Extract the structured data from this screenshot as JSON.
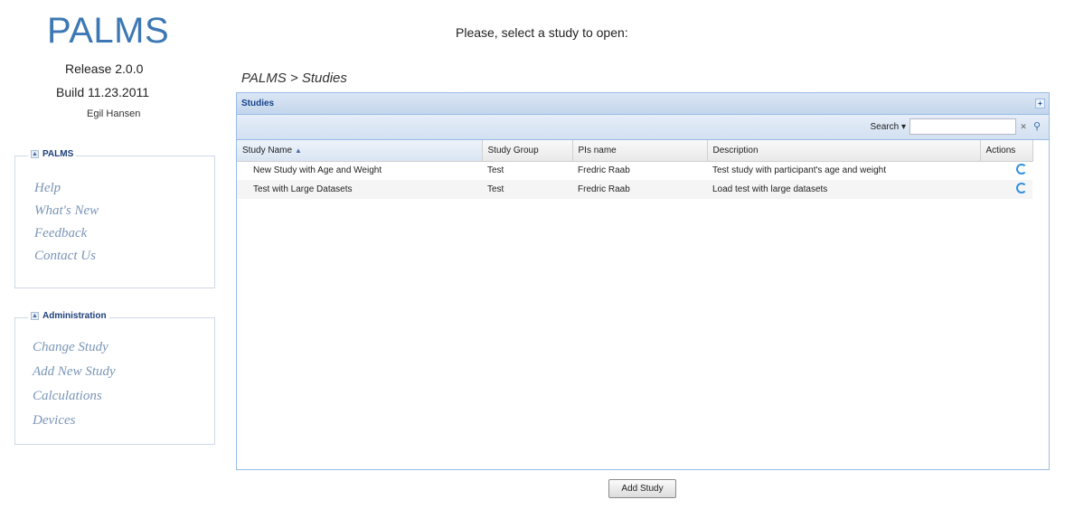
{
  "app": {
    "logo": "PALMS",
    "release": "Release 2.0.0",
    "build": "Build 11.23.2011",
    "author": "Egil Hansen"
  },
  "sidebar": {
    "palms": {
      "title": "PALMS",
      "items": [
        {
          "label": "Help"
        },
        {
          "label": "What's New"
        },
        {
          "label": "Feedback"
        },
        {
          "label": "Contact Us"
        }
      ]
    },
    "administration": {
      "title": "Administration",
      "items": [
        {
          "label": "Change Study"
        },
        {
          "label": "Add New Study"
        },
        {
          "label": "Calculations"
        },
        {
          "label": "Devices"
        }
      ]
    }
  },
  "main": {
    "prompt": "Please, select a study to open:",
    "breadcrumb": "PALMS > Studies",
    "grid": {
      "title": "Studies",
      "search_label": "Search ▾",
      "search_value": "",
      "columns": [
        "Study Name",
        "Study Group",
        "PIs name",
        "Description",
        "Actions"
      ],
      "sort_indicator": "▲",
      "rows": [
        {
          "name": "New Study with Age and Weight",
          "group": "Test",
          "pi": "Fredric Raab",
          "description": "Test study with participant's age and weight"
        },
        {
          "name": "Test with Large Datasets",
          "group": "Test",
          "pi": "Fredric Raab",
          "description": "Load test with large datasets"
        }
      ]
    },
    "add_button": "Add Study"
  },
  "colors": {
    "logo": "#3d78b4",
    "grid_header": "#15428b",
    "link": "#7a95b8"
  }
}
